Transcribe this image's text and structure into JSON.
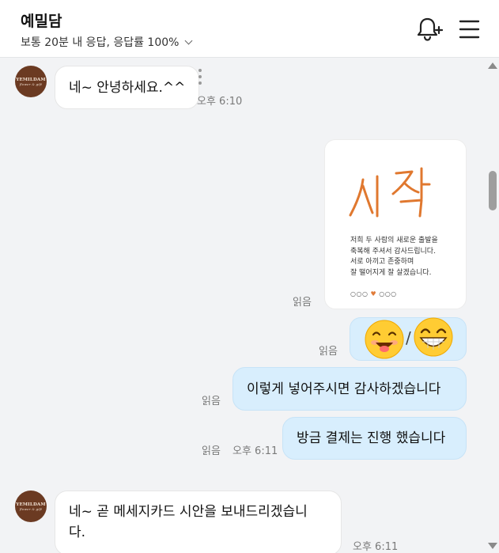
{
  "header": {
    "title": "예밀담",
    "subtitle": "보통 20분 내 응답, 응답률 100%",
    "bell_icon": "bell-plus-icon",
    "menu_icon": "hamburger-menu-icon"
  },
  "avatar": {
    "label": "YEMILDAM",
    "sub": "flower & gift"
  },
  "messages": [
    {
      "side": "in",
      "text": "네~ 안녕하세요.^^",
      "time": "오후 6:10"
    },
    {
      "side": "out",
      "type": "card-image",
      "read": "읽음",
      "card": {
        "title": "시작",
        "body": "저희 두 사람의 새로운 출발을\n축복해 주셔서 감사드립니다.\n서로 아끼고 존중하며\n잘 떨어지게 잘 살겠습니다.",
        "footer_left": "○○○",
        "footer_heart": "♥",
        "footer_right": "○○○"
      }
    },
    {
      "side": "out",
      "type": "emoji",
      "read": "읽음",
      "emojis": [
        "smiling-tongue-emoji",
        "grinning-emoji"
      ],
      "separator": "/"
    },
    {
      "side": "out",
      "text": "이렇게 넣어주시면 감사하겠습니다",
      "read": "읽음"
    },
    {
      "side": "out",
      "text": "방금 결제는 진행 했습니다",
      "read": "읽음",
      "time": "오후 6:11"
    },
    {
      "side": "in",
      "text_line1": "네~ 곧 메세지카드 시안을 보내드리겠습니",
      "text_line2": "다.",
      "time": "오후 6:11"
    }
  ],
  "colors": {
    "bubble_out": "#d8eefd",
    "bubble_in": "#ffffff",
    "background": "#f2f3f5",
    "avatar": "#6b3a22",
    "card_title": "#e0782f"
  }
}
